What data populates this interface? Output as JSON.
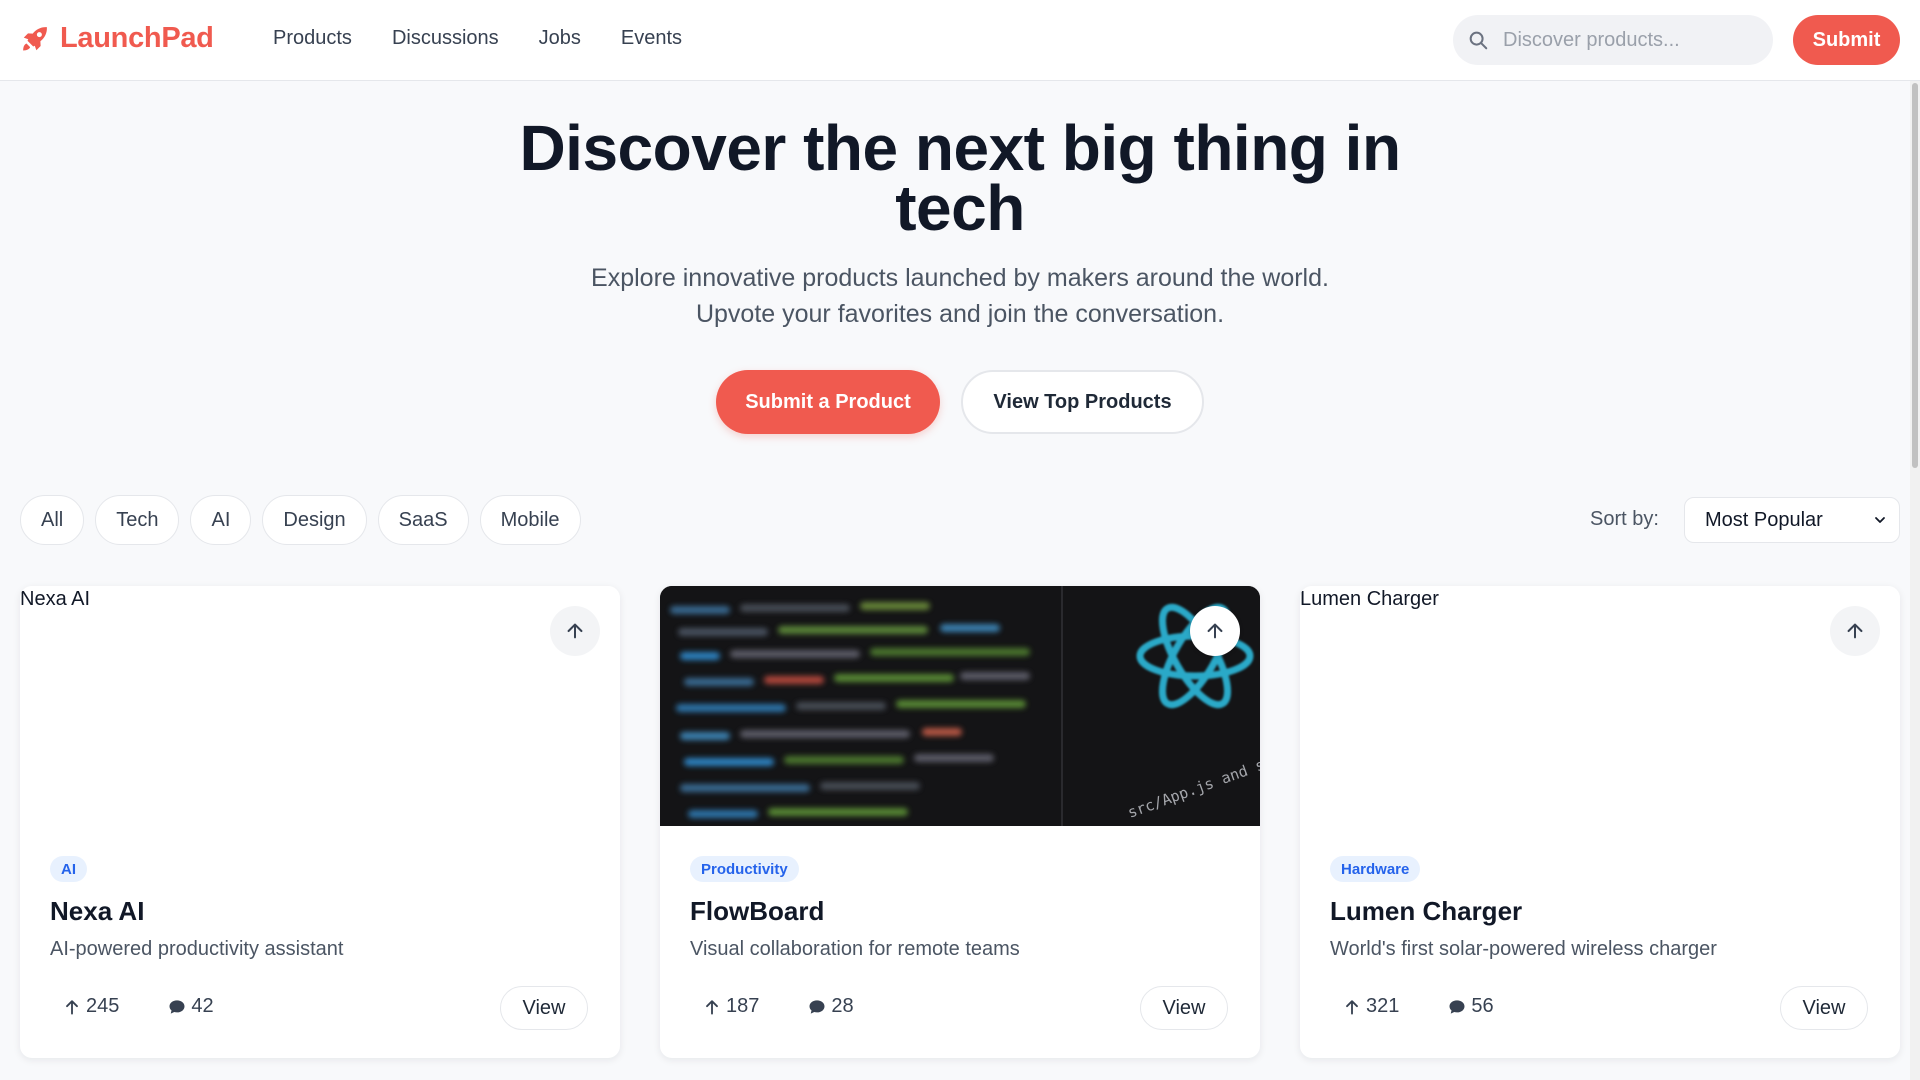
{
  "brand": {
    "name": "LaunchPad",
    "color": "#f05a4f",
    "icon": "rocket-icon"
  },
  "nav": {
    "items": [
      {
        "label": "Products"
      },
      {
        "label": "Discussions"
      },
      {
        "label": "Jobs"
      },
      {
        "label": "Events"
      }
    ]
  },
  "search": {
    "placeholder": "Discover products...",
    "value": ""
  },
  "header": {
    "submit_label": "Submit"
  },
  "hero": {
    "title": "Discover the next big thing in tech",
    "subtitle_line1": "Explore innovative products launched by makers around the world.",
    "subtitle_line2": "Upvote your favorites and join the conversation.",
    "primary_label": "Submit a Product",
    "secondary_label": "View Top Products"
  },
  "filters": {
    "chips": [
      {
        "label": "All"
      },
      {
        "label": "Tech"
      },
      {
        "label": "AI"
      },
      {
        "label": "Design"
      },
      {
        "label": "SaaS"
      },
      {
        "label": "Mobile"
      }
    ],
    "sort_label": "Sort by:",
    "sort_value": "Most Popular"
  },
  "products": [
    {
      "image_alt": "Nexa AI",
      "tag": "AI",
      "name": "Nexa AI",
      "description": "AI-powered productivity assistant",
      "upvotes": "245",
      "comments": "42",
      "view_label": "View"
    },
    {
      "image_alt": "",
      "tag": "Productivity",
      "name": "FlowBoard",
      "description": "Visual collaboration for remote teams",
      "upvotes": "187",
      "comments": "28",
      "view_label": "View",
      "image_text": "src/App.js and save to"
    },
    {
      "image_alt": "Lumen Charger",
      "tag": "Hardware",
      "name": "Lumen Charger",
      "description": "World's first solar-powered wireless charger",
      "upvotes": "321",
      "comments": "56",
      "view_label": "View"
    }
  ],
  "colors": {
    "accent": "#f05a4f",
    "tag_bg": "#e8f1fe",
    "tag_text": "#2563eb",
    "page_bg": "#f8f9fb"
  }
}
